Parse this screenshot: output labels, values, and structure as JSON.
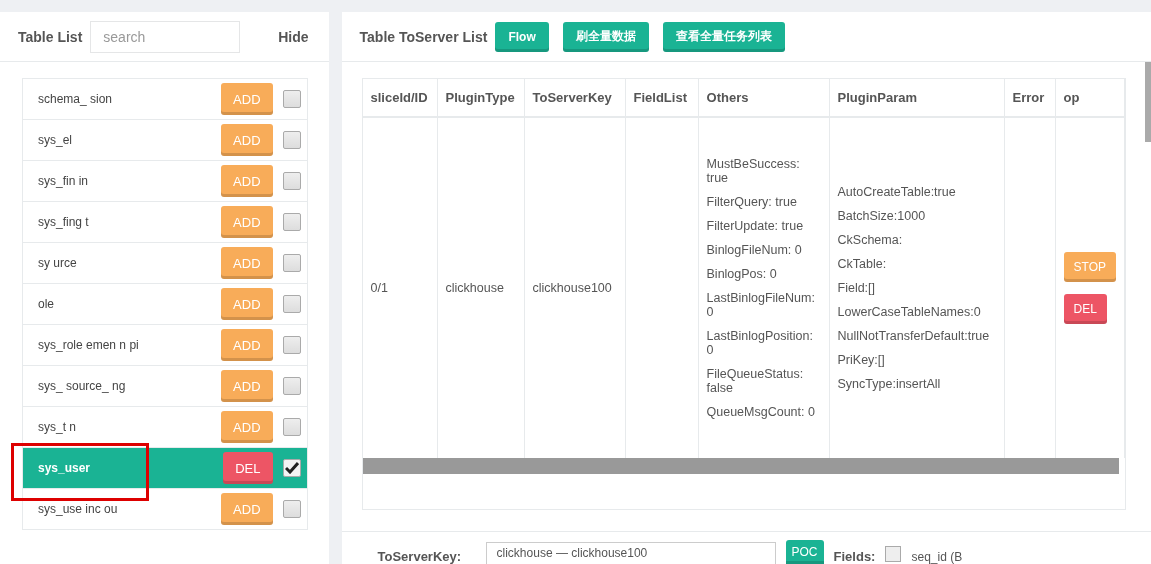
{
  "table_list": {
    "title": "Table List",
    "search": {
      "placeholder": "search"
    },
    "hide": "Hide",
    "items": [
      {
        "name": "schema_ sion",
        "action": "ADD",
        "checked": false,
        "selected": false
      },
      {
        "name": "sys_el",
        "action": "ADD",
        "checked": false,
        "selected": false
      },
      {
        "name": "sys_fin in",
        "action": "ADD",
        "checked": false,
        "selected": false
      },
      {
        "name": "sys_fing t",
        "action": "ADD",
        "checked": false,
        "selected": false
      },
      {
        "name": "sy urce",
        "action": "ADD",
        "checked": false,
        "selected": false
      },
      {
        "name": "ole",
        "action": "ADD",
        "checked": false,
        "selected": false
      },
      {
        "name": "sys_role emen n pi",
        "action": "ADD",
        "checked": false,
        "selected": false
      },
      {
        "name": "sys_ source_ ng",
        "action": "ADD",
        "checked": false,
        "selected": false
      },
      {
        "name": "sys_t n",
        "action": "ADD",
        "checked": false,
        "selected": false
      },
      {
        "name": "sys_user",
        "action": "DEL",
        "checked": true,
        "selected": true
      },
      {
        "name": "sys_use inc ou",
        "action": "ADD",
        "checked": false,
        "selected": false
      }
    ]
  },
  "server_list": {
    "title": "Table ToServer List",
    "buttons": [
      "Flow",
      "刷全量数据",
      "查看全量任务列表"
    ],
    "table": {
      "columns": [
        "sliceId/ID",
        "PluginType",
        "ToServerKey",
        "FieldList",
        "Others",
        "PluginParam",
        "Error",
        "op"
      ],
      "rows": [
        {
          "slice_id": "0/1",
          "plugin_type": "clickhouse",
          "to_server_key": "clickhouse100",
          "field_list": "",
          "others": [
            "MustBeSuccess: true",
            "FilterQuery: true",
            "FilterUpdate: true",
            "BinlogFileNum: 0",
            "BinlogPos: 0",
            "LastBinlogFileNum: 0",
            "LastBinlogPosition: 0",
            "FileQueueStatus: false",
            "QueueMsgCount: 0"
          ],
          "plugin_param": [
            "AutoCreateTable:true",
            "BatchSize:1000",
            "CkSchema:",
            "CkTable:",
            "Field:[]",
            "LowerCaseTableNames:0",
            "NullNotTransferDefault:true",
            "PriKey:[]",
            "SyncType:insertAll"
          ],
          "error": "",
          "ops": [
            {
              "label": "STOP",
              "kind": "warning"
            },
            {
              "label": "DEL",
              "kind": "danger"
            }
          ]
        }
      ]
    }
  },
  "form": {
    "to_server_key_label": "ToServerKey:",
    "to_server_key_value": "clickhouse — clickhouse100",
    "poc_button": "POC",
    "fields_label": "Fields:",
    "field_option": {
      "label": "seq_id (B",
      "checked": false
    }
  }
}
